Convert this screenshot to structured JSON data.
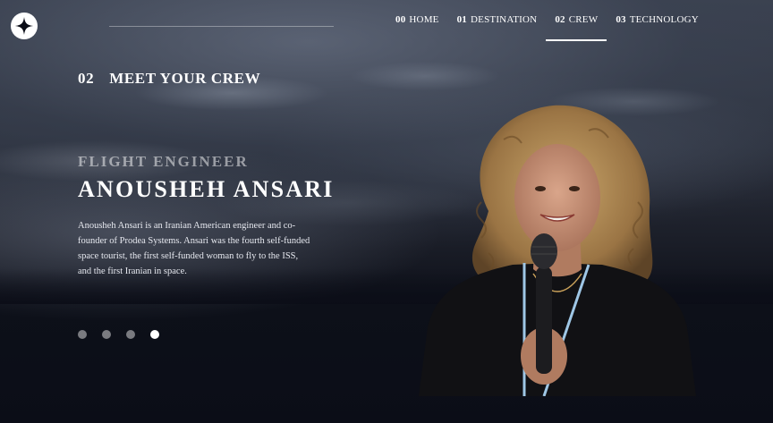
{
  "nav": {
    "items": [
      {
        "num": "00",
        "label": "HOME",
        "active": false
      },
      {
        "num": "01",
        "label": "DESTINATION",
        "active": false
      },
      {
        "num": "02",
        "label": "CREW",
        "active": true
      },
      {
        "num": "03",
        "label": "TECHNOLOGY",
        "active": false
      }
    ]
  },
  "heading": {
    "num": "02",
    "text": "MEET YOUR CREW"
  },
  "crew": {
    "role": "FLIGHT ENGINEER",
    "name": "ANOUSHEH ANSARI",
    "bio": "Anousheh Ansari is an Iranian American engineer and co-founder of Prodea Systems. Ansari was the fourth self-funded space tourist, the first self-funded woman to fly to the ISS, and the first Iranian in space."
  },
  "carousel": {
    "count": 4,
    "active_index": 3
  },
  "colors": {
    "background": "#0b0d17",
    "text": "#ffffff"
  },
  "icons": {
    "logo": "star-logo-icon"
  }
}
